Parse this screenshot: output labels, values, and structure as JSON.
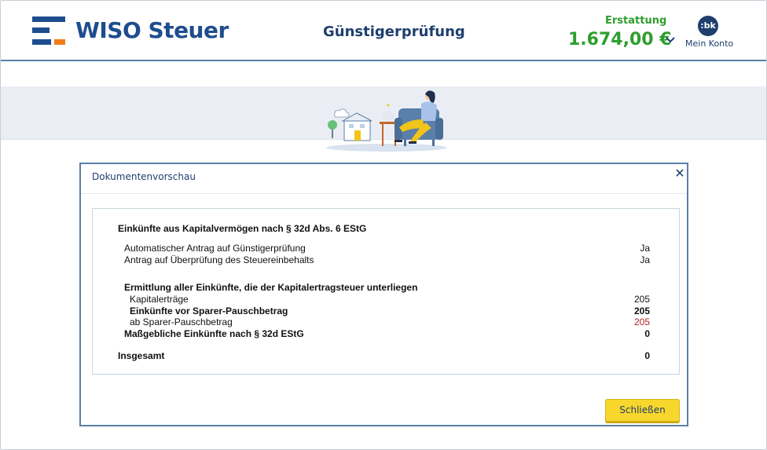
{
  "header": {
    "logo_text": "WISO Steuer",
    "page_title": "Günstigerprüfung",
    "refund_label": "Erstattung",
    "refund_amount": "1.674,00 €",
    "avatar_initials": ":bk",
    "account_label": "Mein Konto"
  },
  "colors": {
    "brand_blue": "#1e4d8f",
    "brand_orange": "#f07d1a",
    "refund_green": "#2e9e2e",
    "button_yellow": "#f8d72c",
    "negative_red": "#b22222"
  },
  "dialog": {
    "title": "Dokumentenvorschau",
    "close_icon": "close-icon",
    "close_button_label": "Schließen",
    "document": {
      "heading": "Einkünfte aus Kapitalvermögen nach § 32d Abs. 6 EStG",
      "rows": [
        {
          "label": "Automatischer Antrag auf Günstigerprüfung",
          "value": "Ja"
        },
        {
          "label": "Antrag auf Überprüfung des Steuereinbehalts",
          "value": "Ja"
        }
      ],
      "section_heading": "Ermittlung aller Einkünfte, die der Kapitalertragsteuer unterliegen",
      "section_rows": [
        {
          "label": "Kapitalerträge",
          "value": "205"
        },
        {
          "label": "Einkünfte vor Sparer-Pauschbetrag",
          "value": "205"
        },
        {
          "label": "ab Sparer-Pauschbetrag",
          "value": "205"
        },
        {
          "label": "Maßgebliche Einkünfte nach § 32d EStG",
          "value": "0"
        }
      ],
      "total_label": "Insgesamt",
      "total_value": "0"
    }
  }
}
